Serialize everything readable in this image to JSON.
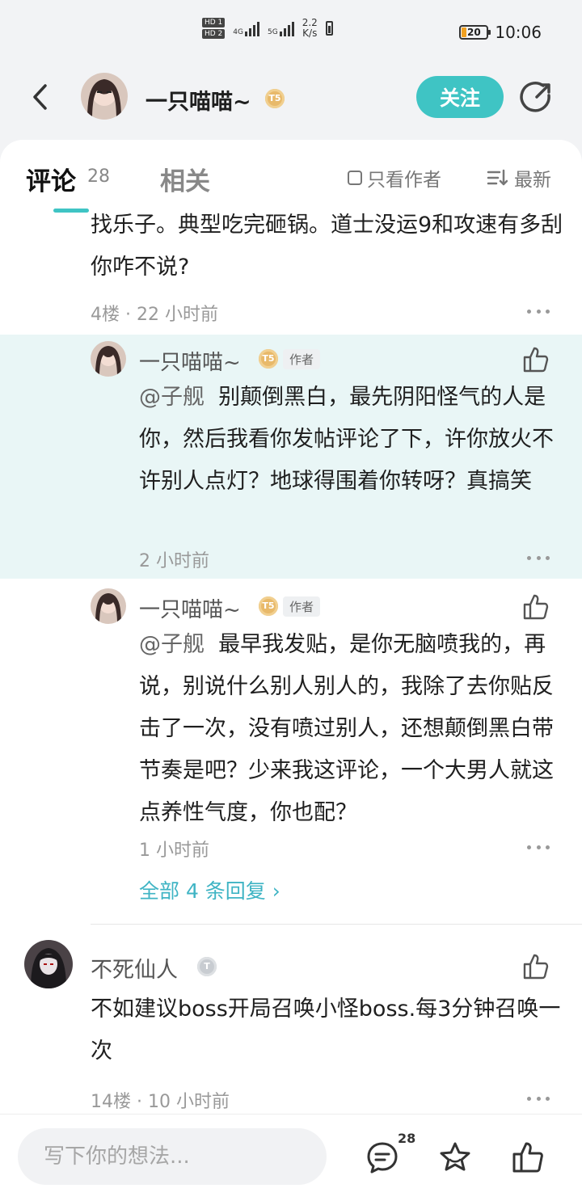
{
  "status_bar": {
    "hd1": "HD 1",
    "hd2": "HD 2",
    "net1": "4G",
    "net2": "5G",
    "speed_value": "2.2",
    "speed_unit": "K/s",
    "battery": "20",
    "time": "10:06"
  },
  "nav": {
    "username": "一只喵喵~",
    "level_badge": "T5",
    "follow_label": "关注"
  },
  "tabs": {
    "comments_label": "评论",
    "comments_count": "28",
    "related_label": "相关",
    "only_author_label": "只看作者",
    "sort_label": "最新"
  },
  "comment_4": {
    "text": "找乐子。典型吃完砸锅。道士没运9和攻速有多刮你咋不说?",
    "floor": "4楼",
    "time": "22 小时前"
  },
  "replies": [
    {
      "name": "一只喵喵~",
      "level_badge": "T5",
      "author_tag": "作者",
      "mention": "@子舰",
      "text": "别颠倒黑白，最先阴阳怪气的人是你，然后我看你发帖评论了下，许你放火不许别人点灯？地球得围着你转呀？真搞笑",
      "time": "2 小时前"
    },
    {
      "name": "一只喵喵~",
      "level_badge": "T5",
      "author_tag": "作者",
      "mention": "@子舰",
      "text": "最早我发贴，是你无脑喷我的，再说，别说什么别人别人的，我除了去你贴反击了一次，没有喷过别人，还想颠倒黑白带节奏是吧？少来我这评论，一个大男人就这点养性气度，你也配？",
      "time": "1 小时前"
    }
  ],
  "all_replies_label": "全部 4 条回复 ›",
  "comment_14": {
    "name": "不死仙人",
    "level_badge": "T",
    "text": "不如建议boss开局召唤小怪boss.每3分钟召唤一次",
    "floor": "14楼",
    "time": "10 小时前"
  },
  "bottom": {
    "input_placeholder": "写下你的想法...",
    "comment_count": "28"
  },
  "colors": {
    "accent": "#3fc4c4",
    "highlight_bg": "#e9f6f6",
    "badge_gold": "#e8b96a"
  },
  "icons": [
    "back-arrow-icon",
    "share-icon",
    "checkbox-icon",
    "sort-icon",
    "more-icon",
    "like-icon",
    "comment-icon",
    "star-icon",
    "thumbs-up-icon"
  ]
}
